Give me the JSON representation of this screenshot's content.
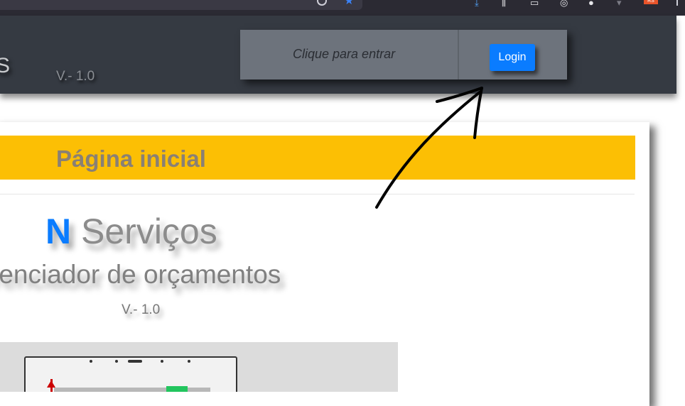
{
  "browser": {
    "extension_icons": [
      "download-icon",
      "library-icon",
      "sidebar-icon",
      "shield-icon",
      "mask-icon",
      "dropdown-icon",
      "rss-icon"
    ],
    "rss_label": "RS"
  },
  "header": {
    "brand_fragment": "S",
    "version": "V.- 1.0",
    "login_hint": "Clique para entrar",
    "login_button": "Login"
  },
  "main": {
    "page_title": "Página inicial",
    "company_initial": "N",
    "company_name": "Serviços",
    "subtitle": "renciador de orçamentos",
    "version": "V.- 1.0"
  },
  "colors": {
    "header_bg": "#353a42",
    "login_box_bg": "#6d737c",
    "accent_blue": "#0a7cff",
    "title_bar_yellow": "#fcbf04"
  }
}
